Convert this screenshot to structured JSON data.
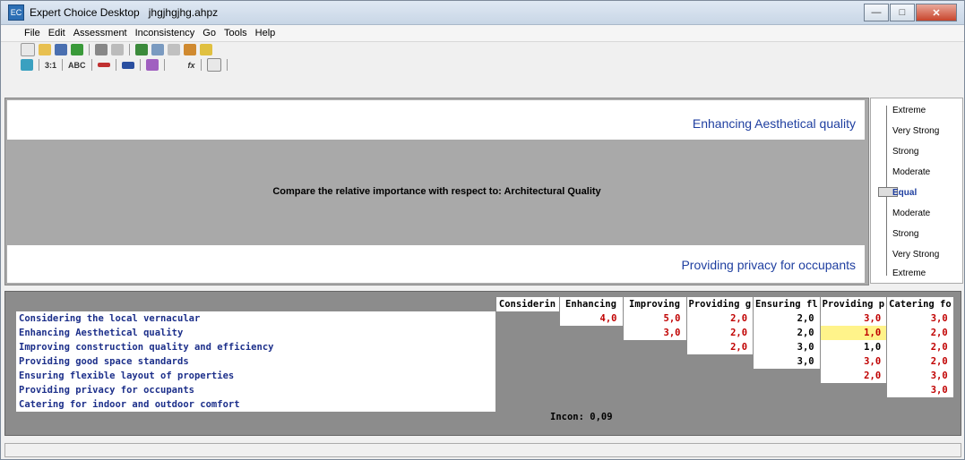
{
  "window": {
    "app": "Expert Choice Desktop",
    "file": "jhgjhgjhg.ahpz"
  },
  "menu": [
    "File",
    "Edit",
    "Assessment",
    "Inconsistency",
    "Go",
    "Tools",
    "Help"
  ],
  "toolbar2": {
    "ratio_label": "3:1",
    "abc_label": "ABC",
    "fx_label": "fx"
  },
  "comparison": {
    "top_element": "Enhancing Aesthetical quality",
    "bottom_element": "Providing privacy for occupants",
    "question": "Compare the relative importance with respect to: Architectural  Quality"
  },
  "scale": [
    "Extreme",
    "Very Strong",
    "Strong",
    "Moderate",
    "Equal",
    "Moderate",
    "Strong",
    "Very Strong",
    "Extreme"
  ],
  "matrix": {
    "col_headers": [
      "Considerin",
      "Enhancing",
      "Improving",
      "Providing g",
      "Ensuring fl",
      "Providing p",
      "Catering fo"
    ],
    "row_headers": [
      "Considering the local vernacular",
      "Enhancing Aesthetical quality",
      "Improving construction quality and efficiency",
      "Providing good space standards",
      "Ensuring flexible layout of properties",
      "Providing privacy for occupants",
      "Catering for indoor and outdoor comfort"
    ],
    "values": [
      [
        "",
        "4,0",
        "5,0",
        "2,0",
        "2,0",
        "3,0",
        "3,0"
      ],
      [
        "",
        "",
        "3,0",
        "2,0",
        "2,0",
        "1,0",
        "2,0"
      ],
      [
        "",
        "",
        "",
        "2,0",
        "3,0",
        "1,0",
        "2,0"
      ],
      [
        "",
        "",
        "",
        "",
        "3,0",
        "3,0",
        "2,0"
      ],
      [
        "",
        "",
        "",
        "",
        "",
        "2,0",
        "3,0"
      ],
      [
        "",
        "",
        "",
        "",
        "",
        "",
        "3,0"
      ],
      [
        "",
        "",
        "",
        "",
        "",
        "",
        ""
      ]
    ],
    "inconsistency": "Incon: 0,09"
  },
  "colors": {
    "red_value": "#c00000",
    "black_value": "#000000",
    "highlight": "#fff38a",
    "element_text": "#1f3fa0"
  },
  "icons": [
    "new-icon",
    "open-icon",
    "save-icon",
    "check-icon",
    "print-icon",
    "preview-icon",
    "calculator-icon",
    "sync-icon",
    "chart-icon",
    "hierarchy-icon",
    "exit-icon"
  ]
}
